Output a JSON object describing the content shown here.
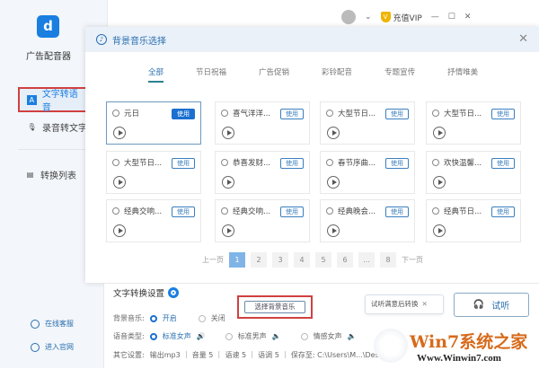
{
  "app": {
    "name": "广告配音器",
    "logo_letter": "d"
  },
  "sidebar": {
    "items": [
      {
        "label": "文字转语音",
        "active": true
      },
      {
        "label": "录音转文字"
      },
      {
        "label": "转换列表"
      }
    ],
    "footer": [
      {
        "label": "在线客服"
      },
      {
        "label": "进入官网"
      }
    ]
  },
  "topbar": {
    "vip_label": "充值VIP",
    "vip_badge": "V",
    "min": "—",
    "max": "☐",
    "close": "✕",
    "dropdown": "⌄"
  },
  "dialog": {
    "title": "背景音乐选择",
    "close": "✕",
    "tabs": [
      {
        "label": "全部",
        "active": true
      },
      {
        "label": "节日祝福"
      },
      {
        "label": "广告促销"
      },
      {
        "label": "彩铃配音"
      },
      {
        "label": "专题宣传"
      },
      {
        "label": "抒情唯美"
      }
    ],
    "use_label": "使用",
    "tracks": [
      "元日",
      "喜气洋洋...",
      "大型节日...",
      "大型节日...",
      "大型节日...",
      "恭喜发财...",
      "春节序曲...",
      "欢快温馨...",
      "经典交响...",
      "经典交响...",
      "经典晚会...",
      "经典节日..."
    ],
    "pager": {
      "prev": "上一页",
      "next": "下一页",
      "pages": [
        "1",
        "2",
        "3",
        "4",
        "5",
        "6",
        "...",
        "8"
      ],
      "current": "1"
    }
  },
  "settings": {
    "title": "文字转换设置",
    "bgm_label": "背景音乐:",
    "bgm_on": "开启",
    "bgm_off": "关闭",
    "select_bgm": "选择背景音乐",
    "voice_label": "语音类型:",
    "voices": [
      "标准女声",
      "标准男声",
      "情感女声"
    ],
    "other_label": "其它设置:",
    "other": "输出mp3 ｜ 音量 5 ｜ 语速 5 ｜ 语调 5 ｜ 保存至: C:\\Users\\M...\\Deskto",
    "tip": "试听满意后转换",
    "tip_close": "✕",
    "listen": "试听"
  },
  "watermark": {
    "text": "Win7系统之家",
    "url": "Www.Winwin7.com"
  }
}
